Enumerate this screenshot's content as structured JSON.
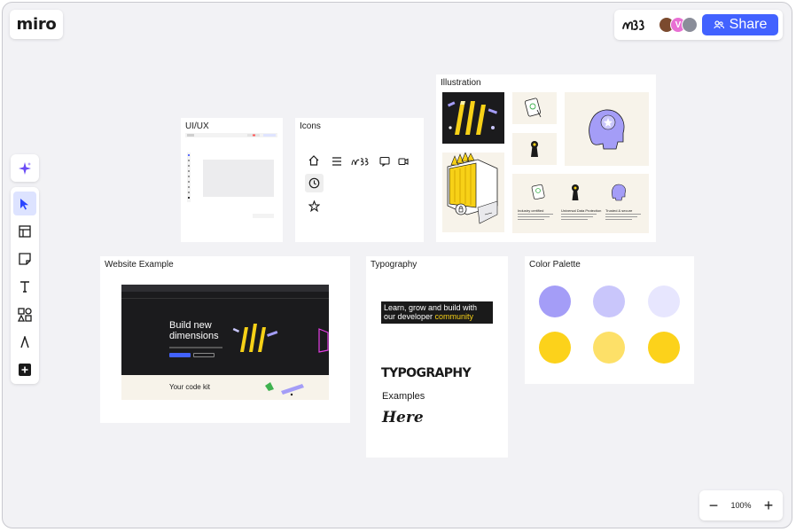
{
  "app": {
    "logo_text": "miro"
  },
  "collab": {
    "share_label": "Share",
    "avatars": [
      {
        "initial": ""
      },
      {
        "initial": "V"
      },
      {
        "initial": ""
      }
    ]
  },
  "toolbar": {
    "tools": [
      "ai-assist",
      "select",
      "templates",
      "sticky-note",
      "text",
      "shapes",
      "pen",
      "add"
    ]
  },
  "frames": {
    "uiux": {
      "title": "UI/UX"
    },
    "icons": {
      "title": "Icons"
    },
    "illustration": {
      "title": "Illustration",
      "card_captions": [
        "Industry certified",
        "Universal Data Protection",
        "Trusted & secure"
      ]
    },
    "website": {
      "title": "Website Example",
      "hero": "Build new dimensions",
      "code_kit": "Your code kit"
    },
    "typography": {
      "title": "Typography",
      "banner_line1": "Learn, grow and build with",
      "banner_line2_prefix": "our developer ",
      "banner_line2_highlight": "community",
      "big": "TYPOGRAPHY",
      "examples": "Examples",
      "here": "Here"
    },
    "palette": {
      "title": "Color Palette",
      "colors": [
        "#a49df7",
        "#c9c6fb",
        "#e7e6fe",
        "#fcd21b",
        "#fde068",
        "#fcd21b"
      ]
    }
  },
  "zoom": {
    "level": "100%",
    "minus": "−",
    "plus": "+"
  }
}
